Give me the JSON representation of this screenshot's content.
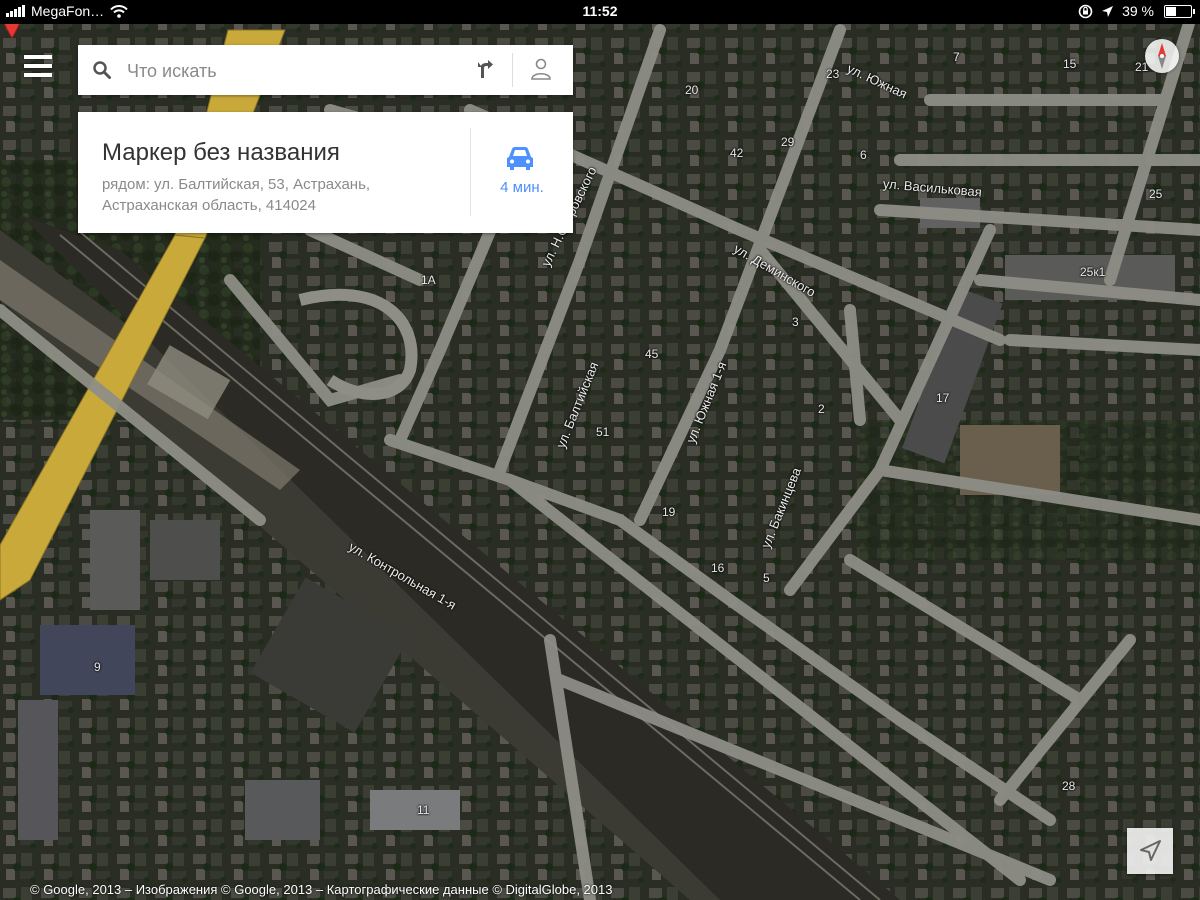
{
  "status_bar": {
    "carrier": "MegaFon…",
    "time": "11:52",
    "battery": "39 %",
    "battery_level": 0.39
  },
  "search": {
    "placeholder": "Что искать",
    "value": ""
  },
  "place_card": {
    "title": "Маркер без названия",
    "address_line1": "рядом: ул. Балтийская, 53, Астрахань,",
    "address_line2": "Астраханская область, 414024",
    "travel_mode_icon": "car-icon",
    "travel_time": "4 мин."
  },
  "map": {
    "type": "satellite",
    "street_labels": [
      "ул. Южная",
      "ул. Васильковая",
      "ул. Деминского",
      "ул. Н.Островского",
      "ул. Балтийская",
      "ул. Южная 1-я",
      "ул. Бакинцева",
      "ул. Контрольная 1-я"
    ],
    "house_numbers": [
      "7",
      "15",
      "21",
      "23",
      "20",
      "42",
      "29",
      "6",
      "25",
      "25к1",
      "1А",
      "3",
      "45",
      "2",
      "17",
      "51",
      "19",
      "16",
      "5",
      "9",
      "11",
      "28"
    ],
    "marker_color": "#e53935",
    "highway_color": "#c9a93a"
  },
  "copyright": "© Google, 2013 – Изображения © Google, 2013 – Картографические данные © DigitalGlobe, 2013",
  "icons": {
    "menu": "menu-icon",
    "search": "search-icon",
    "directions": "directions-icon",
    "account": "account-icon",
    "compass": "compass-icon",
    "locate": "my-location-icon",
    "marker": "map-marker-icon"
  }
}
